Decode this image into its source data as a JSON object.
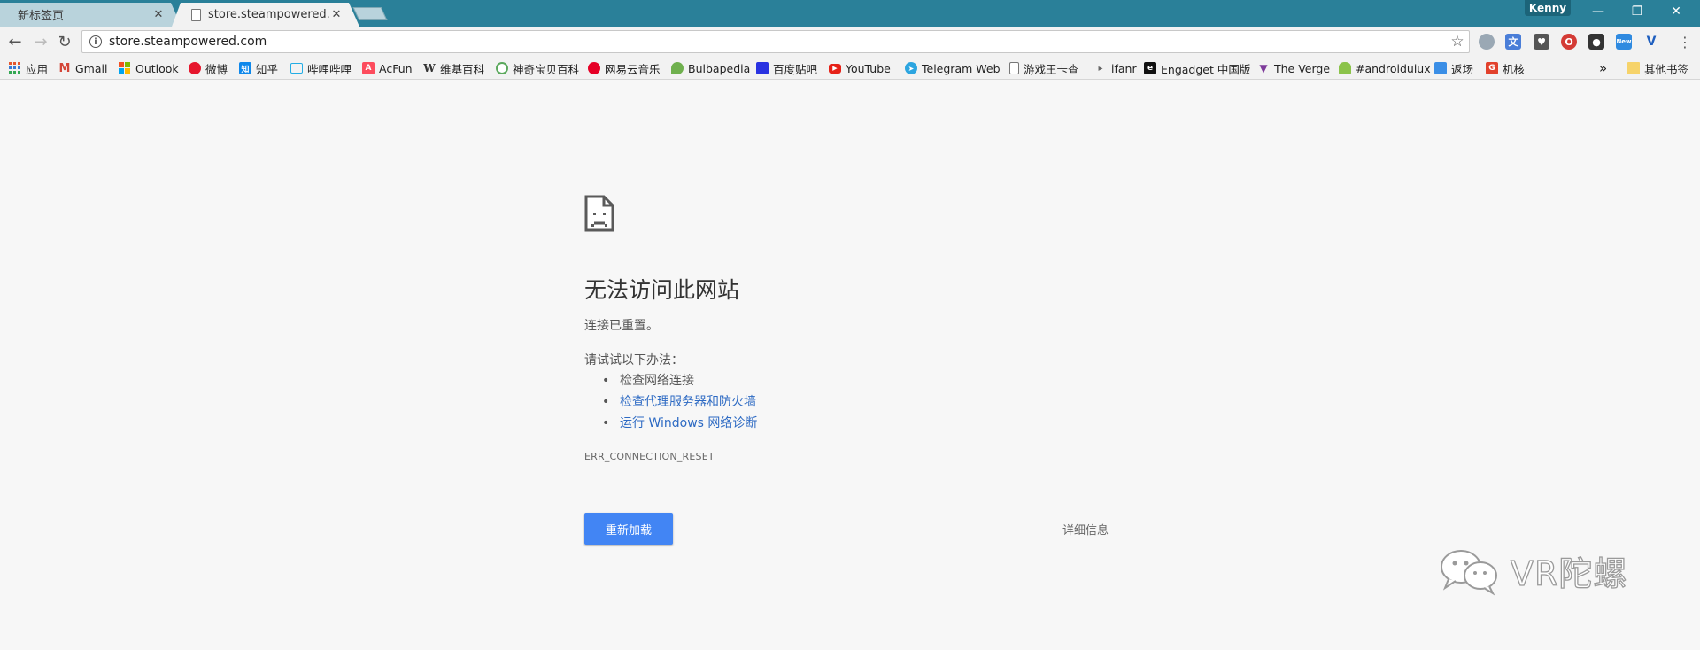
{
  "tabs": [
    {
      "title": "新标签页",
      "active": false
    },
    {
      "title": "store.steampowered.co",
      "active": true
    }
  ],
  "window": {
    "profile_name": "Kenny",
    "minimize": "—",
    "restore": "❐",
    "close": "✕"
  },
  "toolbar": {
    "back": "←",
    "forward": "→",
    "reload": "↻",
    "url": "store.steampowered.com",
    "info": "i",
    "star": "☆",
    "menu": "⋮"
  },
  "extensions": [
    {
      "name": "ext-1-icon",
      "color": "#9aa8b4",
      "glyph": ""
    },
    {
      "name": "translate-icon",
      "color": "#4a7ed8",
      "glyph": "文"
    },
    {
      "name": "pocket-icon",
      "color": "#555555",
      "glyph": "♥"
    },
    {
      "name": "opera-icon",
      "color": "#d43b35",
      "glyph": "O"
    },
    {
      "name": "ghost-icon",
      "color": "#333333",
      "glyph": "●"
    },
    {
      "name": "new-ext-icon",
      "color": "#2f8ae0",
      "glyph": "New"
    },
    {
      "name": "v-icon",
      "color": "#1f5fbf",
      "glyph": "V"
    }
  ],
  "bookmarks": [
    {
      "label": "应用",
      "icon": "apps-icon",
      "color": "#e4572e"
    },
    {
      "label": "Gmail",
      "icon": "gmail-icon",
      "color": "#d44638"
    },
    {
      "label": "Outlook",
      "icon": "outlook-icon",
      "color": "#f25022"
    },
    {
      "label": "微博",
      "icon": "weibo-icon",
      "color": "#e6162d"
    },
    {
      "label": "知乎",
      "icon": "zhihu-icon",
      "color": "#0f88eb"
    },
    {
      "label": "哔哩哔哩",
      "icon": "bilibili-icon",
      "color": "#23ade5"
    },
    {
      "label": "AcFun",
      "icon": "acfun-icon",
      "color": "#fd4c5d"
    },
    {
      "label": "维基百科",
      "icon": "wikipedia-icon",
      "color": "#333333"
    },
    {
      "label": "神奇宝贝百科",
      "icon": "pokemon-wiki-icon",
      "color": "#5aa85c"
    },
    {
      "label": "网易云音乐",
      "icon": "netease-music-icon",
      "color": "#e60026"
    },
    {
      "label": "Bulbapedia",
      "icon": "bulbapedia-icon",
      "color": "#6fb04e"
    },
    {
      "label": "百度贴吧",
      "icon": "baidu-tieba-icon",
      "color": "#2932e1"
    },
    {
      "label": "YouTube",
      "icon": "youtube-icon",
      "color": "#e62117"
    },
    {
      "label": "Telegram Web",
      "icon": "telegram-icon",
      "color": "#2ca5e0"
    },
    {
      "label": "游戏王卡查",
      "icon": "page-icon",
      "color": "#ffffff"
    },
    {
      "label": "ifanr",
      "icon": "ifanr-icon",
      "color": "#666666"
    },
    {
      "label": "Engadget 中国版",
      "icon": "engadget-icon",
      "color": "#111111"
    },
    {
      "label": "The Verge",
      "icon": "verge-icon",
      "color": "#7d3a9a"
    },
    {
      "label": "#androiduiux",
      "icon": "android-icon",
      "color": "#8bc34a"
    },
    {
      "label": "返场",
      "icon": "fanchang-icon",
      "color": "#3a8ee6"
    },
    {
      "label": "机核",
      "icon": "gcores-icon",
      "color": "#e2412c"
    }
  ],
  "bookmarks_overflow": "»",
  "other_bookmarks": "其他书签",
  "error": {
    "title": "无法访问此网站",
    "description": "连接已重置。",
    "suggest_label": "请试试以下办法：",
    "suggestions": [
      {
        "text": "检查网络连接",
        "link": false
      },
      {
        "text": "检查代理服务器和防火墙",
        "link": true
      },
      {
        "text": "运行 Windows 网络诊断",
        "link": true
      }
    ],
    "code": "ERR_CONNECTION_RESET",
    "reload_label": "重新加载",
    "details_label": "详细信息"
  },
  "watermark": {
    "text": "VR陀螺"
  }
}
